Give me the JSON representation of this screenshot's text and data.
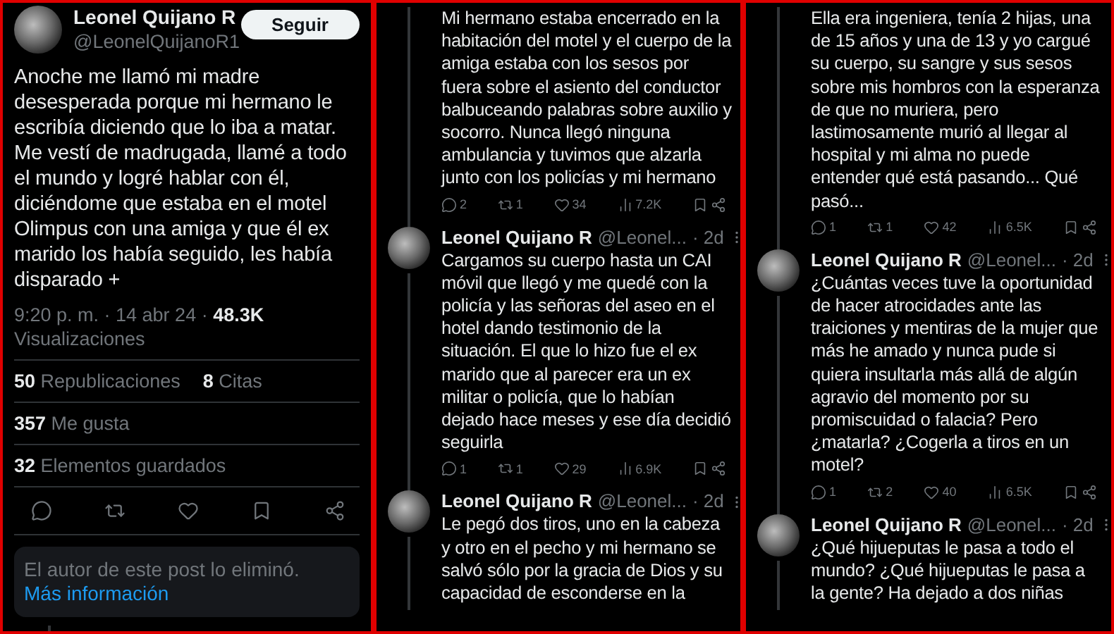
{
  "main_post": {
    "author": {
      "name": "Leonel Quijano R",
      "handle": "@LeonelQuijanoR1"
    },
    "follow_button": "Seguir",
    "text": "Anoche me llamó mi madre desesperada porque mi hermano le escribía diciendo que lo iba a matar. Me vestí de madrugada, llamé a todo el mundo y logré hablar con él, diciéndome que estaba en el motel Olimpus con una amiga y que él ex marido los había seguido, les había disparado +",
    "timestamp": "9:20 p. m. · 14 abr 24 · ",
    "views": "48.3K",
    "views_label": "Visualizaciones",
    "stat_rows": [
      [
        "**50** Republicaciones",
        "**8** Citas"
      ],
      [
        "**357** Me gusta"
      ],
      [
        "**32** Elementos guardados"
      ]
    ],
    "deleted_notice": {
      "text": "El autor de este post lo eliminó.",
      "link": "Más información"
    }
  },
  "thread_columns": [
    {
      "posts": [
        {
          "text": "Mi hermano estaba encerrado en la habitación del motel y el cuerpo de la amiga estaba con los sesos por fuera sobre el asiento del conductor balbuceando palabras sobre auxilio y socorro. Nunca llegó ninguna ambulancia y tuvimos que alzarla junto con los policías y mi hermano",
          "metrics": {
            "replies": "2",
            "reposts": "1",
            "likes": "34",
            "views": "7.2K"
          }
        },
        {
          "author": {
            "name": "Leonel Quijano R",
            "handle": "@Leonel...",
            "time": "· 2d"
          },
          "text": "Cargamos su cuerpo hasta un CAI móvil que llegó y me quedé con la policía y las señoras del aseo en el hotel dando testimonio de la situación. El que lo hizo fue el ex marido que al parecer era un ex militar o policía, que lo habían dejado hace meses y ese día decidió seguirla",
          "metrics": {
            "replies": "1",
            "reposts": "1",
            "likes": "29",
            "views": "6.9K"
          }
        },
        {
          "author": {
            "name": "Leonel Quijano R",
            "handle": "@Leonel...",
            "time": "· 2d"
          },
          "text": "Le pegó dos tiros, uno en la cabeza y otro en el pecho y mi hermano se salvó sólo por la gracia de Dios y su capacidad de esconderse en la"
        }
      ]
    },
    {
      "posts": [
        {
          "text": "Ella era ingeniera, tenía 2 hijas, una de 15 años y una de 13 y yo cargué su cuerpo, su sangre y sus sesos sobre mis hombros con la esperanza de que no muriera, pero lastimosamente murió al llegar al hospital y mi alma no puede entender qué está pasando... Qué pasó...",
          "metrics": {
            "replies": "1",
            "reposts": "1",
            "likes": "42",
            "views": "6.5K"
          }
        },
        {
          "author": {
            "name": "Leonel Quijano R",
            "handle": "@Leonel...",
            "time": "· 2d"
          },
          "text": "¿Cuántas veces tuve la oportunidad de hacer atrocidades ante las traiciones y mentiras de la mujer que más he amado y nunca pude si quiera insultarla más allá de algún agravio del momento por su promiscuidad o falacia? Pero ¿matarla? ¿Cogerla a tiros en un motel?",
          "metrics": {
            "replies": "1",
            "reposts": "2",
            "likes": "40",
            "views": "6.5K"
          }
        },
        {
          "author": {
            "name": "Leonel Quijano R",
            "handle": "@Leonel...",
            "time": "· 2d"
          },
          "text": "¿Qué hijueputas le pasa a todo el mundo? ¿Qué hijueputas le pasa a la gente? Ha dejado a dos niñas"
        }
      ]
    }
  ]
}
